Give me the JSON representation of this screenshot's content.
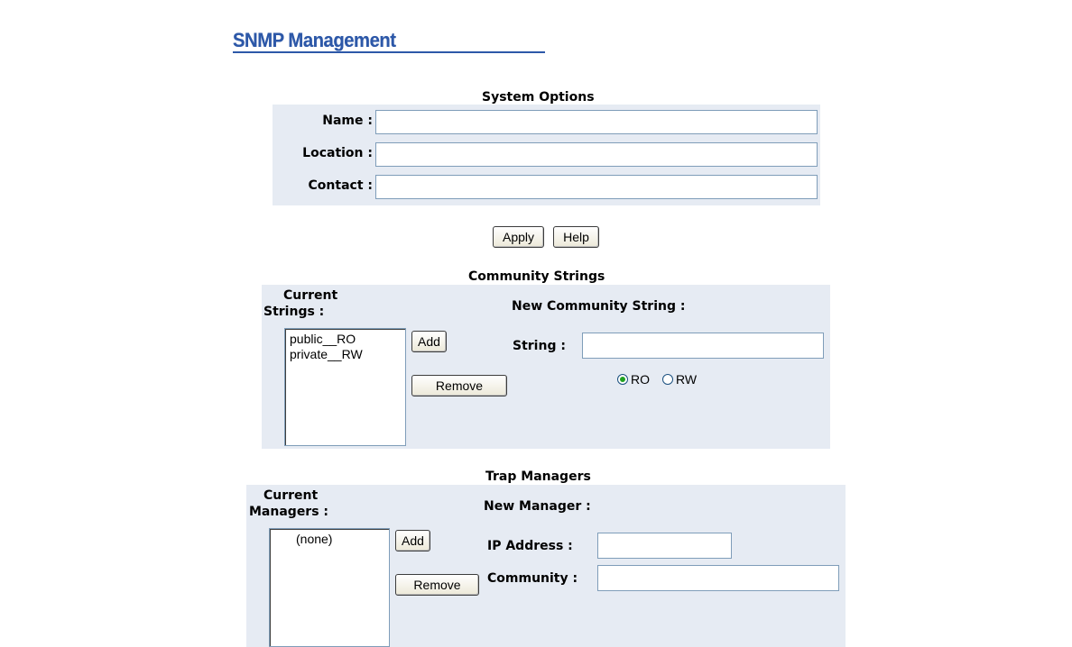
{
  "page_title": "SNMP Management",
  "system_options": {
    "title": "System Options",
    "name_label": "Name :",
    "name_value": "",
    "location_label": "Location :",
    "location_value": "",
    "contact_label": "Contact :",
    "contact_value": "",
    "apply_label": "Apply",
    "help_label": "Help"
  },
  "community_strings": {
    "title": "Community Strings",
    "current_label_line1": "Current",
    "current_label_line2": "Strings :",
    "current_items": [
      "public__RO",
      "private__RW"
    ],
    "add_label": "Add",
    "remove_label": "Remove",
    "new_label": "New Community String :",
    "string_label": "String :",
    "string_value": "",
    "access_options": [
      "RO",
      "RW"
    ],
    "access_selected": "RO"
  },
  "trap_managers": {
    "title": "Trap Managers",
    "current_label_line1": "Current",
    "current_label_line2": "Managers :",
    "current_items": [
      "(none)"
    ],
    "add_label": "Add",
    "remove_label": "Remove",
    "new_label": "New Manager :",
    "ip_label": "IP Address :",
    "ip_value": "",
    "community_label": "Community :",
    "community_value": ""
  },
  "colors": {
    "title": "#2d58a8",
    "panel_bg": "#e6ebf3",
    "radio_dot": "#21a121"
  }
}
